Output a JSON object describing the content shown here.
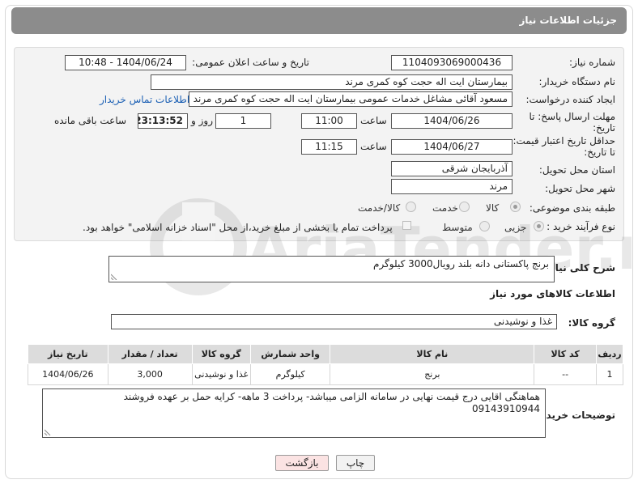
{
  "header": {
    "title": "جزئیات اطلاعات نیاز"
  },
  "form": {
    "need_number": {
      "label": "شماره نیاز:",
      "value": "1104093069000436"
    },
    "announce_datetime": {
      "label": "تاریخ و ساعت اعلان عمومی:",
      "value": "1404/06/24 - 10:48"
    },
    "buyer_org": {
      "label": "نام دستگاه خریدار:",
      "value": "بیمارستان ایت اله حجت کوه کمری مرند"
    },
    "requester": {
      "label": "ایجاد کننده درخواست:",
      "value": "مسعود آقائی مشاغل خدمات عمومی بیمارستان ایت اله حجت کوه کمری مرند",
      "contact_link": "اطلاعات تماس خریدار"
    },
    "reply_deadline": {
      "label_line1": "مهلت ارسال پاسخ: تا",
      "label_line2": "تاریخ:",
      "date": "1404/06/26",
      "time_label": "ساعت",
      "time": "11:00",
      "days": "1",
      "days_label": "روز و",
      "remaining": "23:13:52",
      "remaining_label": "ساعت باقی مانده"
    },
    "price_validity": {
      "label_line1": "حداقل تاریخ اعتبار قیمت:",
      "label_line2": "تا تاریخ:",
      "date": "1404/06/27",
      "time_label": "ساعت",
      "time": "11:15"
    },
    "province": {
      "label": "استان محل تحویل:",
      "value": "آذربایجان شرقی"
    },
    "city": {
      "label": "شهر محل تحویل:",
      "value": "مرند"
    },
    "category": {
      "label": "طبقه بندی موضوعی:",
      "options": [
        "کالا",
        "خدمت",
        "کالا/خدمت"
      ],
      "selected": "کالا"
    },
    "purchase_type": {
      "label": "نوع فرآیند خرید :",
      "options": [
        "جزیی",
        "متوسط"
      ],
      "selected": "جزیی",
      "payment_note": "پرداخت تمام یا بخشی از مبلغ خرید،از محل \"اسناد خزانه اسلامی\" خواهد بود."
    }
  },
  "description": {
    "label": "شرح کلی نیاز:",
    "value": "برنج پاکستانی دانه بلند رویال3000 کیلوگرم"
  },
  "goods_section": {
    "title": "اطلاعات کالاهای مورد نیاز"
  },
  "goods_group": {
    "label": "گروه کالا:",
    "value": "غذا و نوشیدنی"
  },
  "goods_table": {
    "headers": [
      "ردیف",
      "کد کالا",
      "نام کالا",
      "واحد شمارش",
      "گروه کالا",
      "تعداد / مقدار",
      "تاریخ نیاز"
    ],
    "rows": [
      [
        "1",
        "--",
        "برنج",
        "کیلوگرم",
        "غذا و نوشیدنی",
        "3,000",
        "1404/06/26"
      ]
    ]
  },
  "buyer_notes": {
    "label": "توضیحات خریدار:",
    "line1": "هماهنگی اقایی درج قیمت نهایی در سامانه الزامی میباشد- پرداخت 3 ماهه- کرایه حمل بر عهده فروشند",
    "line2": "09143910944"
  },
  "buttons": {
    "print": "چاپ",
    "back": "بازگشت"
  },
  "watermark": {
    "text": "AriaTender.neT"
  },
  "colors": {
    "header_bg": "#8c8c8c",
    "link": "#1a5fb4",
    "back_button_bg": "#fbe3e3"
  }
}
